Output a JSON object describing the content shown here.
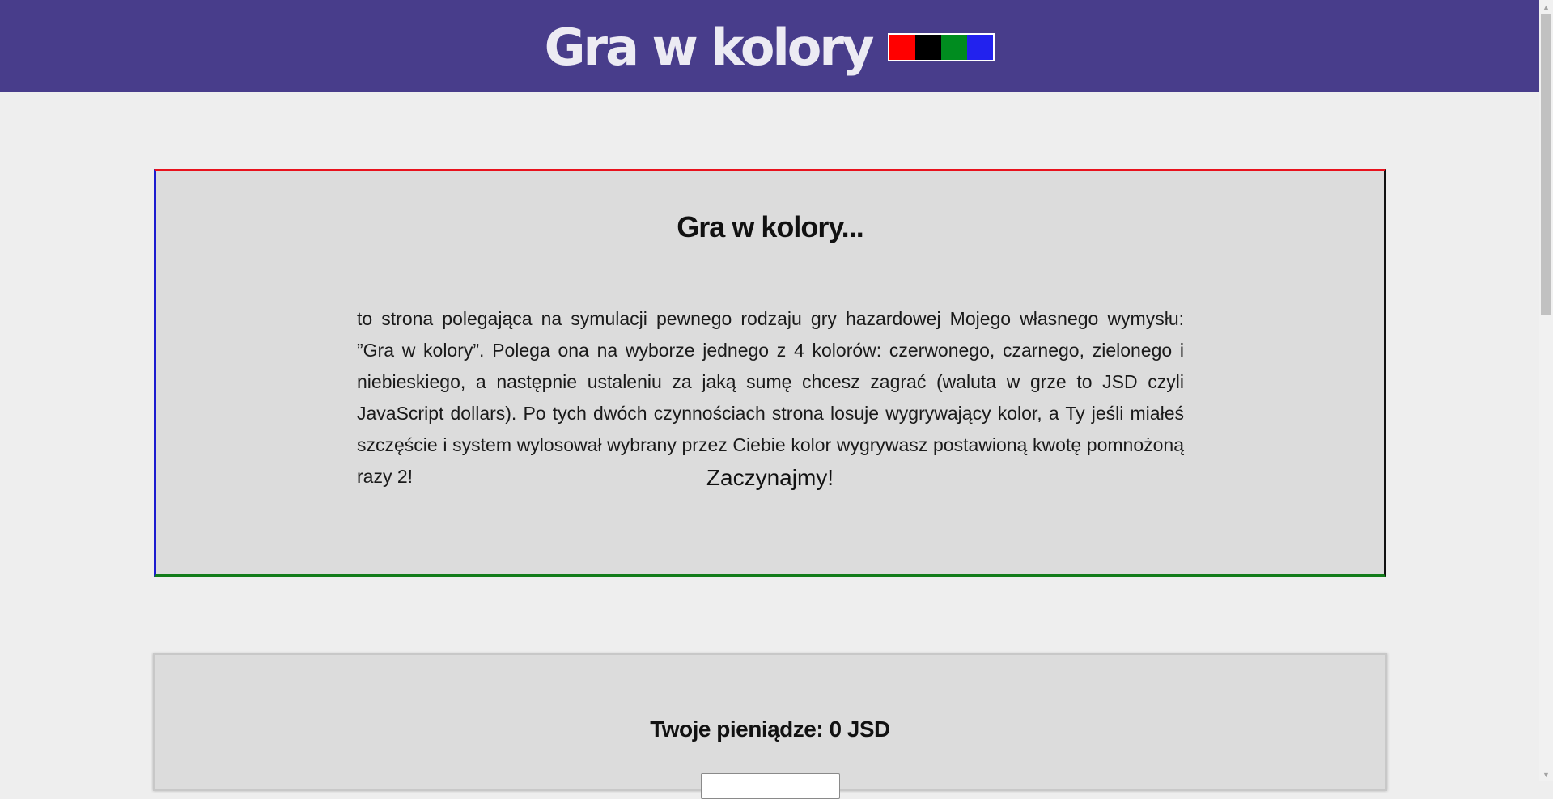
{
  "header": {
    "title": "Gra w kolory",
    "swatches": [
      {
        "name": "red",
        "color": "#ff0000"
      },
      {
        "name": "black",
        "color": "#000000"
      },
      {
        "name": "green",
        "color": "#008c1f"
      },
      {
        "name": "blue",
        "color": "#2222ee"
      }
    ]
  },
  "intro": {
    "title": "Gra w kolory...",
    "text": "to strona polegająca na symulacji pewnego rodzaju gry hazardowej Mojego własnego wymysłu: ”Gra w kolory”. Polega ona na wyborze jednego z 4 kolorów: czerwonego, czarnego, zielonego i niebieskiego, a następnie ustaleniu za jaką sumę chcesz zagrać (waluta w grze to JSD czyli JavaScript dollars). Po tych dwóch czynnościach strona losuje wygrywający kolor, a Ty jeśli miałeś szczęście i system wylosował wybrany przez Ciebie kolor wygrywasz postawioną kwotę pomnożoną razy 2!",
    "cta": "Zaczynajmy!"
  },
  "money": {
    "label": "Twoje pieniądze: 0 JSD",
    "input_value": ""
  },
  "colors": {
    "header_bg": "#483d8b",
    "page_bg": "#eeeeee",
    "card_bg": "#dcdcdc"
  }
}
